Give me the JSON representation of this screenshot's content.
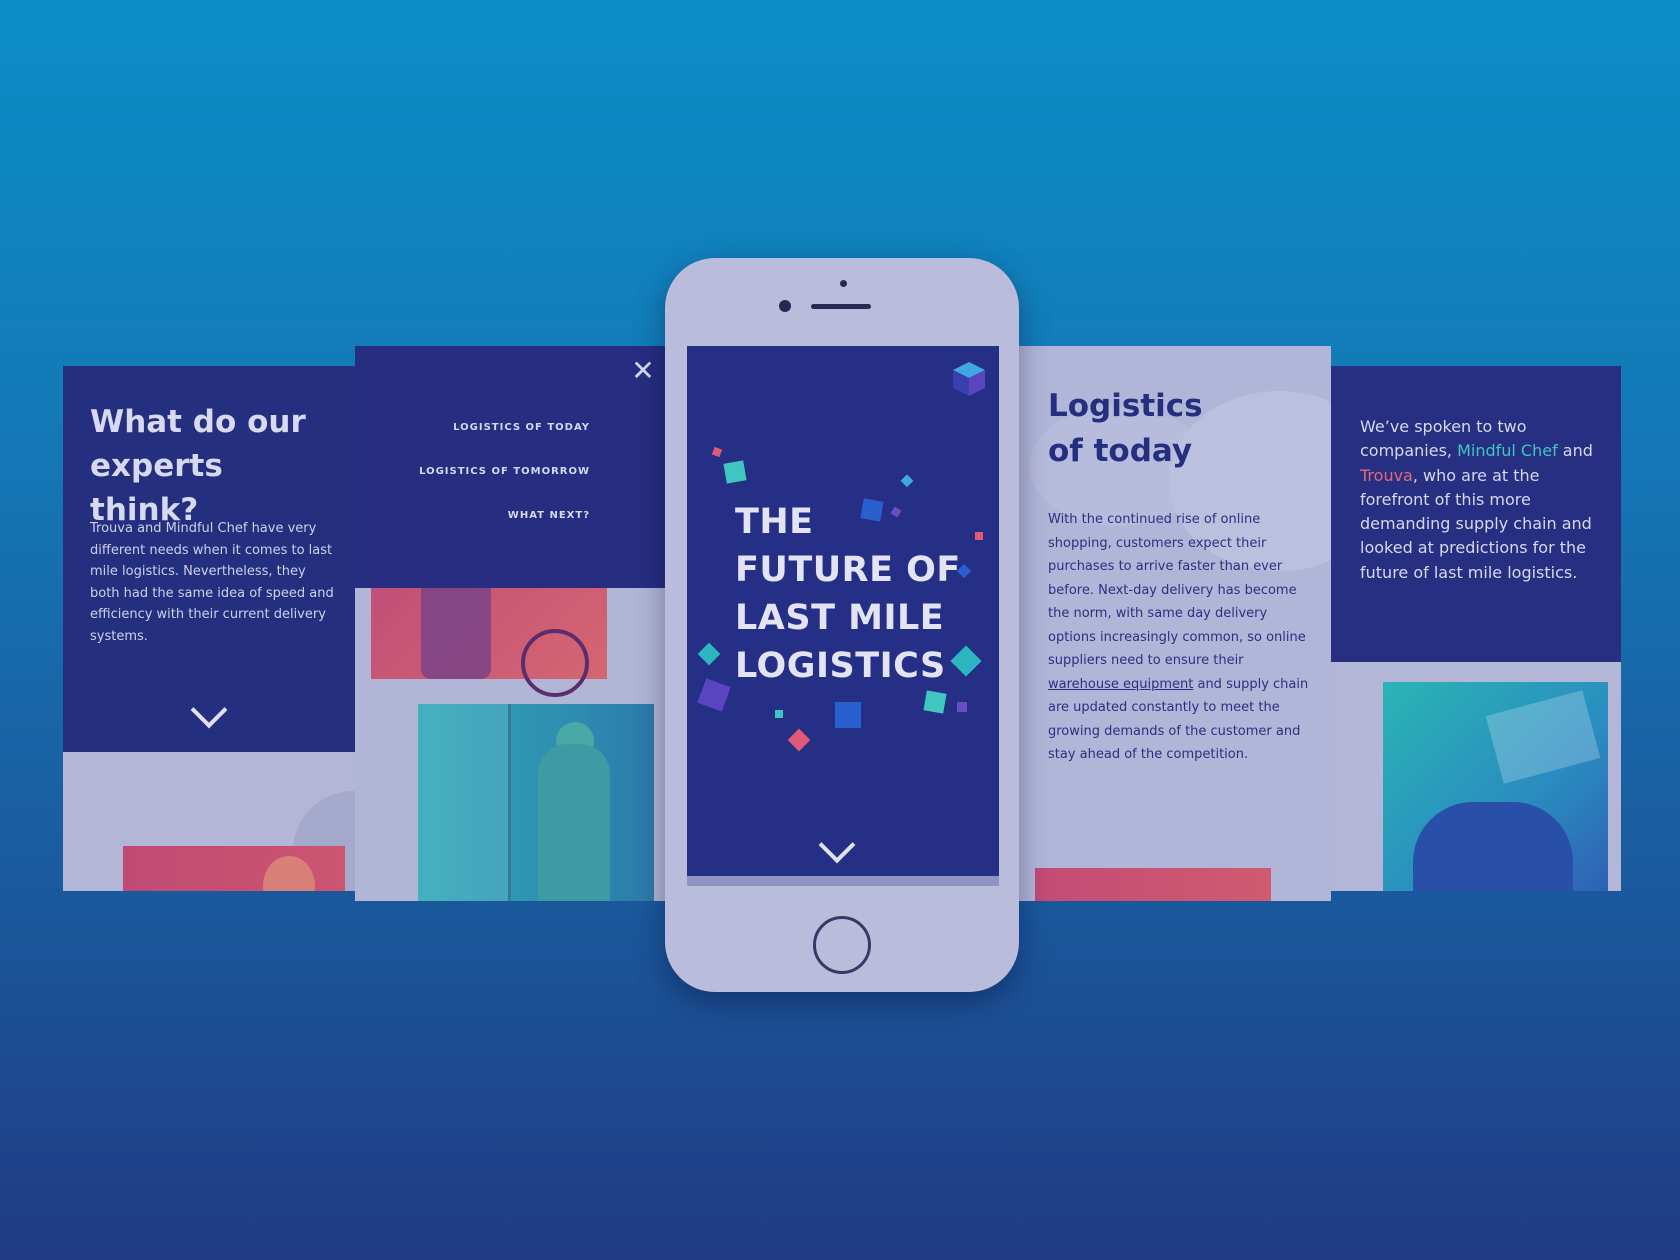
{
  "panel_experts": {
    "heading": "What do our experts think?",
    "body": "Trouva and Mindful Chef have very different needs when it comes to last mile logistics. Nevertheless, they both had the same idea of speed and efficiency with their current delivery systems."
  },
  "panel_menu": {
    "close_glyph": "✕",
    "items": [
      "LOGISTICS OF TODAY",
      "LOGISTICS OF TOMORROW",
      "WHAT NEXT?"
    ]
  },
  "phone": {
    "title_lines": [
      "THE",
      "FUTURE OF",
      "LAST MILE",
      "LOGISTICS"
    ]
  },
  "panel_today": {
    "heading_line1": "Logistics",
    "heading_line2": "of today",
    "body_before_link": "With the continued rise of online shopping, customers expect their purchases to arrive faster than ever before. Next-day delivery has become the norm, with same day delivery options increasingly common, so online suppliers need to ensure their ",
    "link_text": "warehouse equipment",
    "body_after_link": " and supply chain are updated constantly to meet the growing demands of the customer and stay ahead of the competition."
  },
  "panel_companies": {
    "text_1": "We’ve spoken to two companies, ",
    "brand_1": "Mindful Chef",
    "text_2": " and ",
    "brand_2": "Trouva",
    "text_3": ", who are at the forefront of this more demanding supply chain and looked at predictions for the future of last mile logistics."
  },
  "colors": {
    "background_top": "#0b8ec6",
    "background_bottom": "#203a84",
    "navy": "#262f86",
    "teal": "#3fc6c0",
    "coral": "#e06a7c"
  },
  "icons": [
    "close-icon",
    "chevron-down-icon",
    "cube-logo-icon"
  ]
}
